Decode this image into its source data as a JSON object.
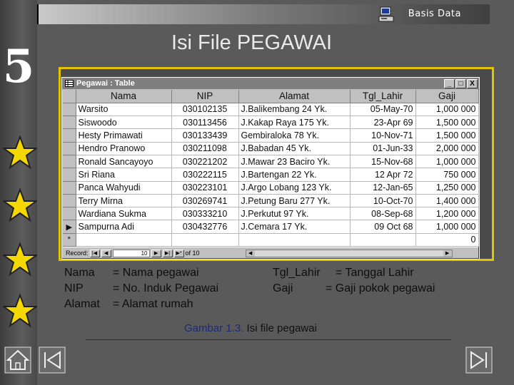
{
  "header": {
    "title": "Basis Data"
  },
  "chapter_number": "5",
  "slide": {
    "title": "Isi File PEGAWAI"
  },
  "window": {
    "title": "Pegawai : Table",
    "buttons": {
      "minimize": "_",
      "maximize": "□",
      "close": "X"
    },
    "columns": [
      "Nama",
      "NIP",
      "Alamat",
      "Tgl_Lahir",
      "Gaji"
    ],
    "rows": [
      [
        "Warsito",
        "030102135",
        "J.Balikembang 24 Yk.",
        "05-May-70",
        "1,000 000"
      ],
      [
        "Siswoodo",
        "030113456",
        "J.Kakap Raya 175 Yk.",
        "23-Apr 69",
        "1,500 000"
      ],
      [
        "Hesty Primawati",
        "030133439",
        "Gembiraloka 78 Yk.",
        "10-Nov-71",
        "1,500 000"
      ],
      [
        "Hendro Pranowo",
        "030211098",
        "J.Babadan 45 Yk.",
        "01-Jun-33",
        "2,000 000"
      ],
      [
        "Ronald Sancayoyo",
        "030221202",
        "J.Mawar 23 Baciro Yk.",
        "15-Nov-68",
        "1,000 000"
      ],
      [
        "Sri Riana",
        "030222115",
        "J.Bartengan 22 Yk.",
        "12 Apr 72",
        "750 000"
      ],
      [
        "Panca Wahyudi",
        "030223101",
        "J.Argo Lobang 123 Yk.",
        "12-Jan-65",
        "1,250 000"
      ],
      [
        "Terry Mirna",
        "030269741",
        "J.Petung Baru 277 Yk.",
        "10-Oct-70",
        "1,400 000"
      ],
      [
        "Wardiana Sukma",
        "030333210",
        "J.Perkutut 97 Yk.",
        "08-Sep-68",
        "1,200 000"
      ],
      [
        "Sampurna Adi",
        "030432776",
        "J.Cemara 17 Yk.",
        "09 Oct 68",
        "1,000 000"
      ]
    ],
    "new_row": {
      "marker": "*",
      "gaji": "0"
    },
    "record_nav": {
      "label": "Record:",
      "current": "10",
      "of_label": "of 10"
    }
  },
  "legend": {
    "left": [
      {
        "term": "Nama",
        "desc": "= Nama pegawai"
      },
      {
        "term": "NIP",
        "desc": "= No. Induk Pegawai"
      },
      {
        "term": "Alamat",
        "desc": "= Alamat rumah"
      }
    ],
    "right": [
      {
        "term": "Tgl_Lahir",
        "desc": "= Tanggal Lahir"
      },
      {
        "term": "Gaji",
        "desc": "= Gaji pokok pegawai"
      }
    ]
  },
  "caption": {
    "number": "Gambar 1.3.",
    "text": "Isi file pegawai"
  },
  "colors": {
    "frame": "#e3c400",
    "star": "#f4d800",
    "background": "#5a5a5a"
  },
  "icons": [
    "computer-icon",
    "star-icon",
    "home-icon",
    "prev-slide-icon",
    "next-slide-icon",
    "table-icon"
  ]
}
